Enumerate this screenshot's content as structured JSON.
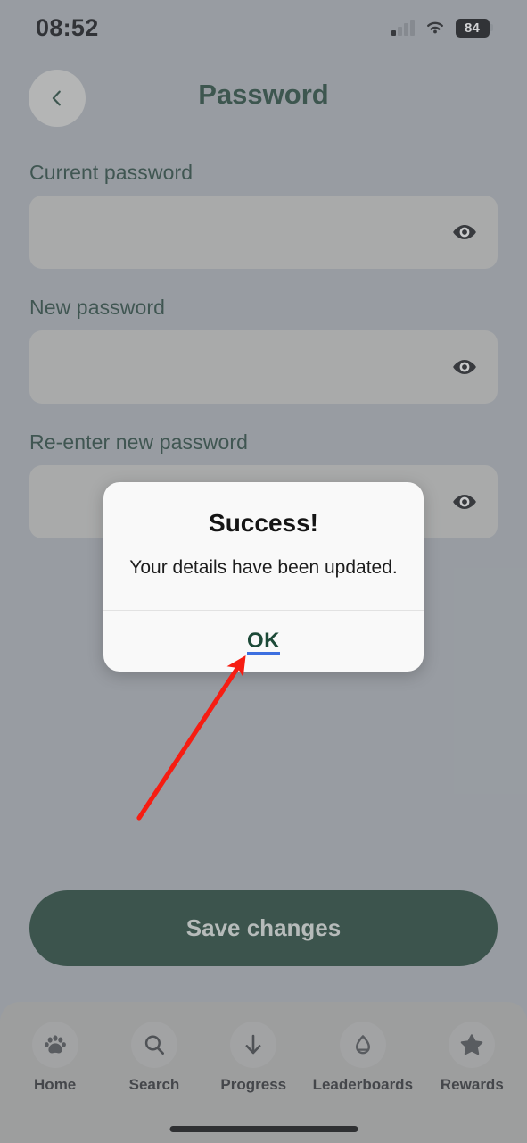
{
  "status_bar": {
    "time": "08:52",
    "signal_icon": "cellular-signal-icon",
    "wifi_icon": "wifi-icon",
    "battery_level": "84",
    "battery_icon": "battery-icon"
  },
  "header": {
    "title": "Password",
    "back_icon": "chevron-left-icon"
  },
  "form": {
    "fields": [
      {
        "label": "Current password",
        "value": "",
        "placeholder": "",
        "toggle_icon": "eye-icon"
      },
      {
        "label": "New password",
        "value": "",
        "placeholder": "",
        "toggle_icon": "eye-icon"
      },
      {
        "label": "Re-enter new password",
        "value": "",
        "placeholder": "",
        "toggle_icon": "eye-icon"
      }
    ],
    "save_label": "Save changes"
  },
  "dialog": {
    "title": "Success!",
    "message": "Your details have been updated.",
    "ok_label": "OK"
  },
  "bottom_nav": {
    "items": [
      {
        "label": "Home",
        "icon": "paw-icon"
      },
      {
        "label": "Search",
        "icon": "search-icon"
      },
      {
        "label": "Progress",
        "icon": "arrow-down-icon"
      },
      {
        "label": "Leaderboards",
        "icon": "trophy-icon"
      },
      {
        "label": "Rewards",
        "icon": "star-icon"
      }
    ]
  },
  "annotation": {
    "arrow_color": "#f61d12",
    "points_to": "OK"
  },
  "colors": {
    "background": "#a9aeb4",
    "brand_green": "#1d4032",
    "field": "#c2c2c0",
    "dialog_bg": "#f9f9f9",
    "ok_text": "#1d4a38",
    "ok_underline": "#3d6fe0",
    "nav_bar": "#b0b0ae"
  }
}
